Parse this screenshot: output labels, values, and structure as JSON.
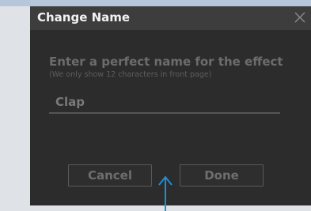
{
  "dialog": {
    "title": "Change Name",
    "close_icon": "close-icon",
    "heading": "Enter a perfect name for the effect",
    "note": "(We only show 12 characters in front page)",
    "name_value": "Clap",
    "cancel_label": "Cancel",
    "done_label": "Done"
  },
  "annotation": {
    "arrow_icon": "up-arrow-icon",
    "arrow_color": "#1a8fd6"
  },
  "colors": {
    "dialog_bg": "#2c2c2c",
    "titlebar_bg": "#3d3d3d",
    "title_text": "#f2f2f2",
    "dim_text": "#6c6c6c"
  }
}
